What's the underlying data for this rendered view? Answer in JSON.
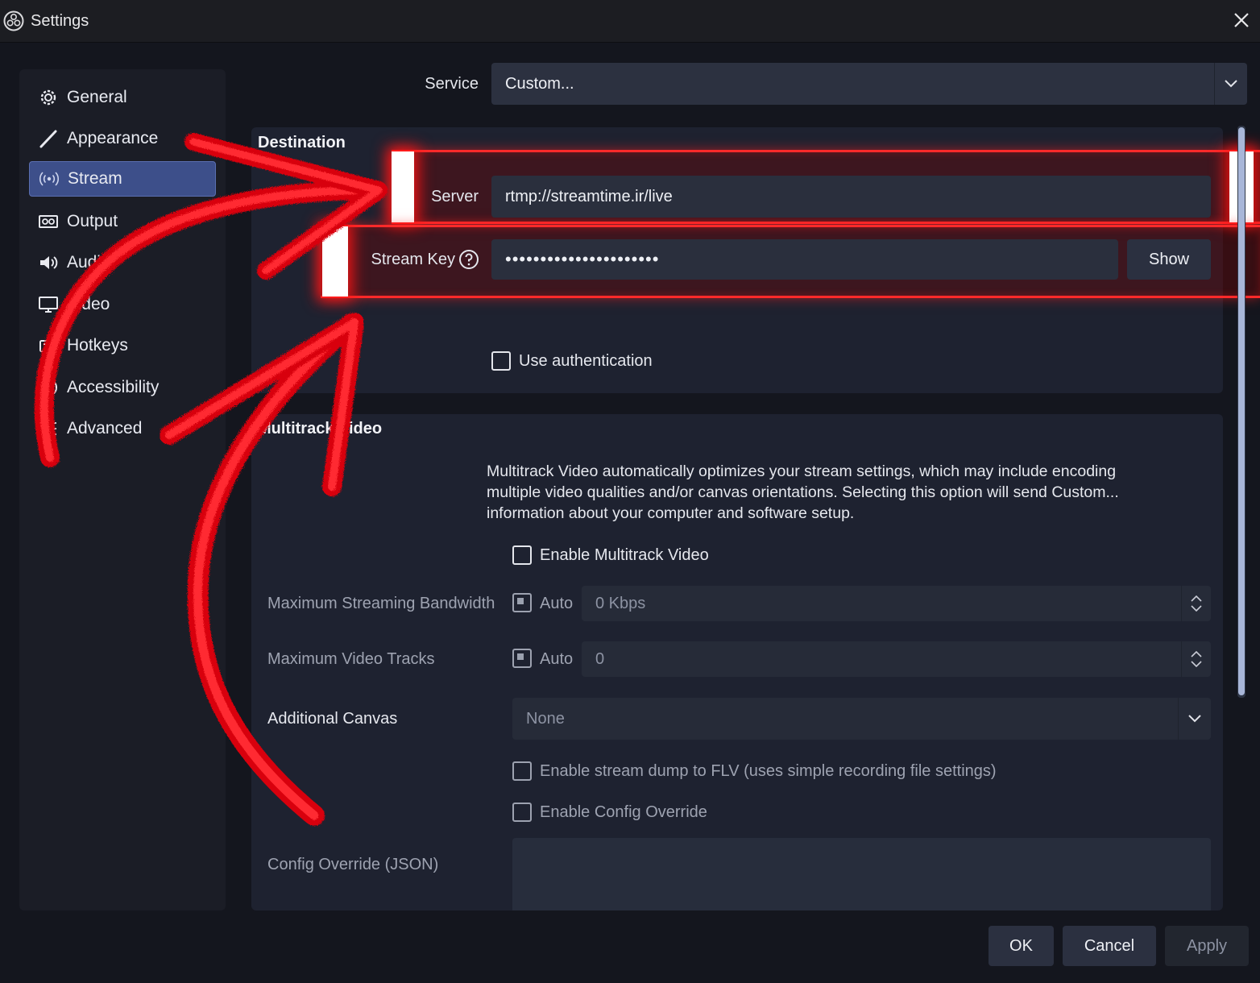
{
  "window": {
    "title": "Settings",
    "icon": "obs-logo-icon",
    "close_icon": "close-icon"
  },
  "sidebar": {
    "items": [
      {
        "label": "General",
        "icon": "gear-icon"
      },
      {
        "label": "Appearance",
        "icon": "brush-icon"
      },
      {
        "label": "Stream",
        "icon": "broadcast-icon",
        "active": true
      },
      {
        "label": "Output",
        "icon": "output-icon"
      },
      {
        "label": "Audio",
        "icon": "speaker-icon"
      },
      {
        "label": "Video",
        "icon": "monitor-icon"
      },
      {
        "label": "Hotkeys",
        "icon": "keyboard-icon"
      },
      {
        "label": "Accessibility",
        "icon": "accessibility-icon"
      },
      {
        "label": "Advanced",
        "icon": "sliders-icon"
      }
    ]
  },
  "service": {
    "label": "Service",
    "value": "Custom..."
  },
  "destination": {
    "title": "Destination",
    "server_label": "Server",
    "server_value": "rtmp://streamtime.ir/live",
    "stream_key_label": "Stream Key",
    "stream_key_value": "••••••••••••••••••••••",
    "show_button": "Show",
    "use_auth_label": "Use authentication"
  },
  "multitrack": {
    "title": "Multitrack Video",
    "description": "Multitrack Video automatically optimizes your stream settings, which may include encoding multiple video qualities and/or canvas orientations. Selecting this option will send Custom... information about your computer and software setup.",
    "enable_label": "Enable Multitrack Video",
    "bandwidth_label": "Maximum Streaming Bandwidth",
    "bandwidth_auto": "Auto",
    "bandwidth_value": "0 Kbps",
    "tracks_label": "Maximum Video Tracks",
    "tracks_auto": "Auto",
    "tracks_value": "0",
    "canvas_label": "Additional Canvas",
    "canvas_value": "None",
    "flv_dump_label": "Enable stream dump to FLV (uses simple recording file settings)",
    "config_override_label": "Enable Config Override",
    "config_json_label": "Config Override (JSON)"
  },
  "footer": {
    "ok": "OK",
    "cancel": "Cancel",
    "apply": "Apply"
  },
  "colors": {
    "accent": "#3d4f8a",
    "highlight": "#ff2a2a",
    "background": "#14161e"
  }
}
